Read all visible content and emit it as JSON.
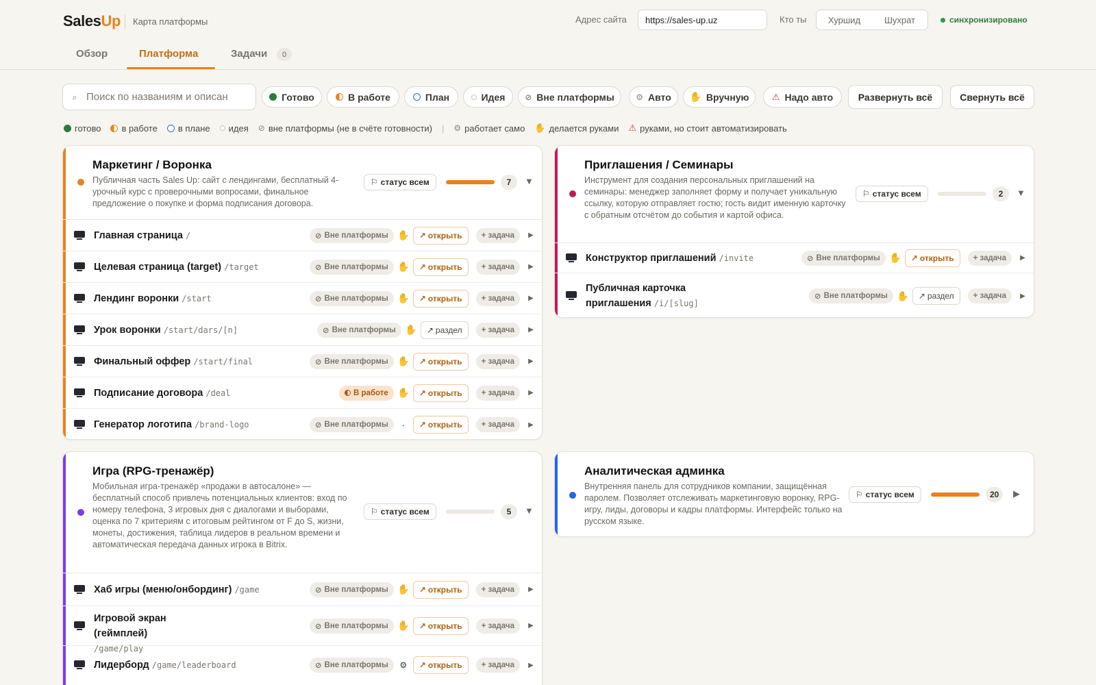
{
  "header": {
    "brand_part1": "Sales",
    "brand_part2": "Up",
    "subtitle": "Карта платформы",
    "site_label": "Адрес сайта",
    "site_value": "https://sales-up.uz",
    "who_label": "Кто ты",
    "who_options": [
      "Хуршид",
      "Шухрат"
    ],
    "sync_status": "синхронизировано"
  },
  "tabs": {
    "overview": "Обзор",
    "platform": "Платформа",
    "tasks": "Задачи",
    "tasks_count": "0",
    "active": "Платформа"
  },
  "filters": {
    "search_placeholder": "Поиск по названиям и описан",
    "done": "Готово",
    "in_progress": "В работе",
    "plan": "План",
    "idea": "Идея",
    "outside": "Вне платформы",
    "auto": "Авто",
    "manual": "Вручную",
    "need_auto": "Надо авто",
    "expand_all": "Развернуть всё",
    "collapse_all": "Свернуть всё"
  },
  "legend": {
    "done": "готово",
    "in_progress": "в работе",
    "plan": "в плане",
    "idea": "идея",
    "outside": "вне платформы (не в счёте готовности)",
    "auto": "работает само",
    "manual": "делается руками",
    "need_auto": "руками, но стоит автоматизировать"
  },
  "icons": {
    "search": "⌕",
    "outside": "⊘",
    "auto": "⚙",
    "manual": "✋",
    "warning": "⚠",
    "flag": "⚐",
    "open_arrow": "↗",
    "expand": "▶",
    "collapse": "▼",
    "dot": "·",
    "plus": "+"
  },
  "colors": {
    "accent": "#e8821e",
    "done": "#2b7a3b",
    "plan": "#2a6fd6",
    "warning": "#d03c3c",
    "marketing": "#e8821e",
    "invites": "#c2185b",
    "game": "#7c3aed",
    "analytics": "#2563eb"
  },
  "labels": {
    "status_all": "статус всем",
    "outside_pill": "Вне платформы",
    "work_pill": "В работе",
    "open": "открыть",
    "section": "раздел",
    "task": "задача"
  },
  "sections": {
    "marketing": {
      "title": "Маркетинг / Воронка",
      "desc": "Публичная часть Sales Up: сайт с лендингами, бесплатный 4-урочный курс с проверочными вопросами, финальное предложение о покупке и форма подписания договора.",
      "count": "7",
      "progress": 1.0,
      "expanded": true,
      "rows": [
        {
          "title": "Главная страница",
          "path": "/",
          "status": "Вне платформы",
          "mode": "✋",
          "action": "открыть"
        },
        {
          "title": "Целевая страница (target)",
          "path": "/target",
          "status": "Вне платформы",
          "mode": "✋",
          "action": "открыть"
        },
        {
          "title": "Лендинг воронки",
          "path": "/start",
          "status": "Вне платформы",
          "mode": "✋",
          "action": "открыть"
        },
        {
          "title": "Урок воронки",
          "path": "/start/dars/[n]",
          "status": "Вне платформы",
          "mode": "✋",
          "action": "раздел"
        },
        {
          "title": "Финальный оффер",
          "path": "/start/final",
          "status": "Вне платформы",
          "mode": "✋",
          "action": "открыть"
        },
        {
          "title": "Подписание договора",
          "path": "/deal",
          "status": "В работе",
          "mode": "✋",
          "action": "открыть"
        },
        {
          "title": "Генератор логотипа",
          "path": "/brand-logo",
          "status": "Вне платформы",
          "mode": "·",
          "action": "открыть"
        }
      ]
    },
    "invites": {
      "title": "Приглашения / Семинары",
      "desc": "Инструмент для создания персональных приглашений на семинары: менеджер заполняет форму и получает уникальную ссылку, которую отправляет гостю; гость видит именную карточку с обратным отсчётом до события и картой офиса.",
      "count": "2",
      "progress": 0.0,
      "expanded": true,
      "rows": [
        {
          "title": "Конструктор приглашений",
          "path": "/invite",
          "status": "Вне платформы",
          "mode": "✋",
          "action": "открыть"
        },
        {
          "title": "Публичная карточка приглашения",
          "path": "/i/[slug]",
          "status": "Вне платформы",
          "mode": "✋",
          "action": "раздел"
        }
      ]
    },
    "game": {
      "title": "Игра (RPG-тренажёр)",
      "desc": "Мобильная игра-тренажёр «продажи в автосалоне» — бесплатный способ привлечь потенциальных клиентов: вход по номеру телефона, 3 игровых дня с диалогами и выборами, оценка по 7 критериям с итоговым рейтингом от F до S, жизни, монеты, достижения, таблица лидеров в реальном времени и автоматическая передача данных игрока в Bitrix.",
      "count": "5",
      "progress": 0.0,
      "expanded": true,
      "rows": [
        {
          "title": "Хаб игры (меню/онбординг)",
          "path": "/game",
          "status": "Вне платформы",
          "mode": "✋",
          "action": "открыть"
        },
        {
          "title": "Игровой экран (геймплей)",
          "path": "/game/play",
          "status": "Вне платформы",
          "mode": "✋",
          "action": "открыть"
        },
        {
          "title": "Лидерборд",
          "path": "/game/leaderboard",
          "status": "Вне платформы",
          "mode": "⚙",
          "action": "открыть"
        }
      ]
    },
    "analytics": {
      "title": "Аналитическая админка",
      "desc": "Внутренняя панель для сотрудников компании, защищённая паролем. Позволяет отслеживать маркетинговую воронку, RPG-игру, лиды, договоры и кадры платформы. Интерфейс только на русском языке.",
      "count": "20",
      "progress": 1.0,
      "expanded": false,
      "rows": []
    }
  }
}
